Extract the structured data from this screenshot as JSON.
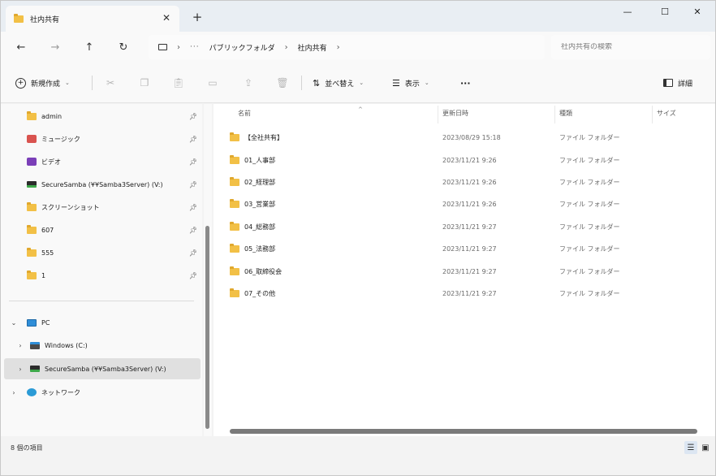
{
  "tab": {
    "title": "社内共有"
  },
  "window_controls": {
    "minimize": "—",
    "maximize": "☐",
    "close": "✕"
  },
  "nav": {
    "back": "←",
    "forward": "→",
    "up": "↑",
    "refresh": "↻"
  },
  "breadcrumb": {
    "more": "···",
    "items": [
      "パブリックフォルダ",
      "社内共有"
    ]
  },
  "search": {
    "placeholder": "社内共有の検索"
  },
  "commands": {
    "new": "新規作成",
    "sort": "並べ替え",
    "view": "表示",
    "more": "···",
    "details": "詳細"
  },
  "sidebar": {
    "quick_access": [
      {
        "label": "admin",
        "icon": "folder-icon"
      },
      {
        "label": "ミュージック",
        "icon": "music-icon"
      },
      {
        "label": "ビデオ",
        "icon": "video-icon"
      },
      {
        "label": "SecureSamba (¥¥Samba3Server) (V:)",
        "icon": "drive-icon"
      },
      {
        "label": "スクリーンショット",
        "icon": "folder-icon"
      },
      {
        "label": "607",
        "icon": "folder-icon"
      },
      {
        "label": "555",
        "icon": "folder-icon"
      },
      {
        "label": "1",
        "icon": "folder-icon"
      }
    ],
    "pc": {
      "label": "PC"
    },
    "pc_children": [
      {
        "label": "Windows (C:)",
        "icon": "win-drive-icon"
      },
      {
        "label": "SecureSamba (¥¥Samba3Server) (V:)",
        "icon": "drive-icon"
      }
    ],
    "network": {
      "label": "ネットワーク"
    }
  },
  "columns": {
    "name": "名前",
    "date": "更新日時",
    "type": "種類",
    "size": "サイズ"
  },
  "files": [
    {
      "name": "【全社共有】",
      "date": "2023/08/29 15:18",
      "type": "ファイル フォルダー"
    },
    {
      "name": "01_人事部",
      "date": "2023/11/21 9:26",
      "type": "ファイル フォルダー"
    },
    {
      "name": "02_経理部",
      "date": "2023/11/21 9:26",
      "type": "ファイル フォルダー"
    },
    {
      "name": "03_営業部",
      "date": "2023/11/21 9:26",
      "type": "ファイル フォルダー"
    },
    {
      "name": "04_総務部",
      "date": "2023/11/21 9:27",
      "type": "ファイル フォルダー"
    },
    {
      "name": "05_法務部",
      "date": "2023/11/21 9:27",
      "type": "ファイル フォルダー"
    },
    {
      "name": "06_取締役会",
      "date": "2023/11/21 9:27",
      "type": "ファイル フォルダー"
    },
    {
      "name": "07_その他",
      "date": "2023/11/21 9:27",
      "type": "ファイル フォルダー"
    }
  ],
  "status": {
    "item_count": "8 個の項目"
  }
}
